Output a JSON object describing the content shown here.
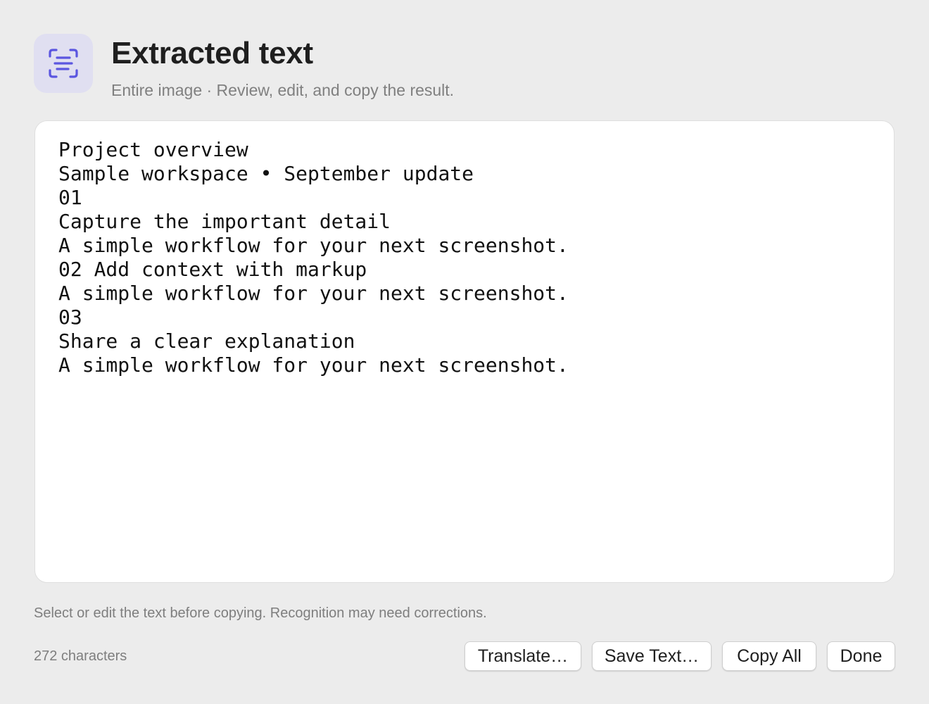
{
  "header": {
    "icon": "text-recognition-icon",
    "title": "Extracted text",
    "subtitle": "Entire image · Review, edit, and copy the result."
  },
  "extracted_text": "Project overview\nSample workspace • September update\n01\nCapture the important detail\nA simple workflow for your next screenshot.\n02 Add context with markup\nA simple workflow for your next screenshot.\n03\nShare a clear explanation\nA simple workflow for your next screenshot.",
  "footer": {
    "hint": "Select or edit the text before copying. Recognition may need corrections.",
    "char_count": "272 characters"
  },
  "buttons": {
    "translate": "Translate…",
    "save_text": "Save Text…",
    "copy_all": "Copy All",
    "done": "Done"
  },
  "colors": {
    "background": "#ececec",
    "icon_tile": "#e0dff1",
    "icon_accent": "#5b56e0",
    "panel": "#ffffff"
  }
}
